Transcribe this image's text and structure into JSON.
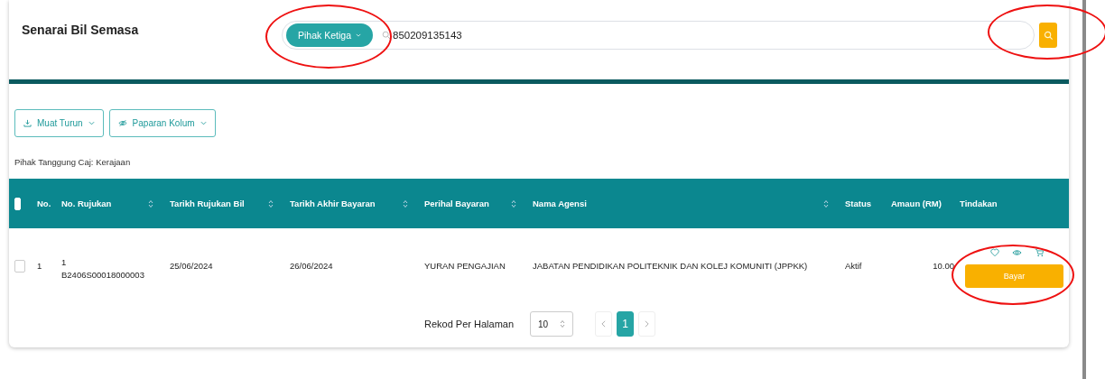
{
  "page_title": "Senarai Bil Semasa",
  "search": {
    "filter": {
      "label": "Pihak Ketiga",
      "circled": true
    },
    "value": "850209135143",
    "button": {
      "circled": true
    }
  },
  "toolbar": [
    {
      "label": "Muat Turun",
      "kind": "download"
    },
    {
      "label": "Paparan Kolum",
      "kind": "columns"
    }
  ],
  "charge_note": "Pihak Tanggung Caj: Kerajaan",
  "table": {
    "select_all": {
      "checked": false
    },
    "columns": [
      {
        "label": "No.",
        "sortable": false
      },
      {
        "label": "No. Rujukan",
        "sortable": true
      },
      {
        "label": "Tarikh Rujukan Bil",
        "sortable": true
      },
      {
        "label": "Tarikh Akhir Bayaran",
        "sortable": true
      },
      {
        "label": "Perihal Bayaran",
        "sortable": true
      },
      {
        "label": "Nama Agensi",
        "sortable": true
      },
      {
        "label": "Status",
        "sortable": false
      },
      {
        "label": "Amaun (RM)",
        "sortable": false
      },
      {
        "label": "Tindakan",
        "sortable": false
      }
    ],
    "rows": [
      {
        "checked": false,
        "no": "1",
        "reference": [
          "1",
          "B2406S00018000003"
        ],
        "bill_date": "25/06/2024",
        "due_date": "26/06/2024",
        "purpose": "YURAN PENGAJIAN",
        "agency": "JABATAN PENDIDIKAN POLITEKNIK DAN KOLEJ KOMUNITI (JPPKK)",
        "status": "Aktif",
        "amount": "10.00",
        "action": {
          "label": "Bayar",
          "circled": true
        }
      }
    ]
  },
  "pagination": {
    "label": "Rekod Per Halaman",
    "page_size": "10",
    "pages": [
      {
        "label": "1",
        "selected": true
      }
    ]
  }
}
